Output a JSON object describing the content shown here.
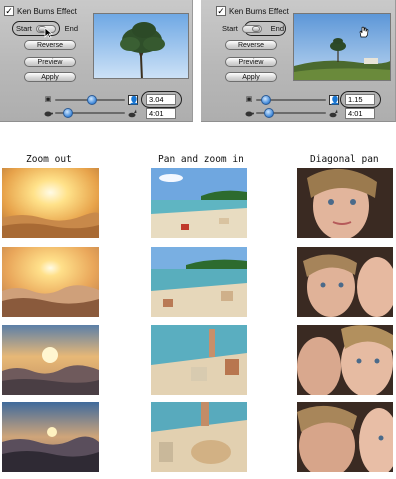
{
  "panels": [
    {
      "checkbox_label": "Ken Burns Effect",
      "checkbox_checked": true,
      "toggle_start": "Start",
      "toggle_end": "End",
      "toggle_selected": "Start",
      "buttons": [
        "Reverse",
        "Preview",
        "Apply"
      ],
      "zoom_value": "3.04",
      "duration_value": "4:01"
    },
    {
      "checkbox_label": "Ken Burns Effect",
      "checkbox_checked": true,
      "toggle_start": "Start",
      "toggle_end": "End",
      "toggle_selected": "End",
      "buttons": [
        "Reverse",
        "Preview",
        "Apply"
      ],
      "zoom_value": "1.15",
      "duration_value": "4:01"
    }
  ],
  "columns": [
    "Zoom out",
    "Pan and zoom in",
    "Diagonal pan"
  ],
  "icons": {
    "checkbox": "checkmark-icon",
    "small_photo": "small-photo-icon",
    "large_photo": "person-icon",
    "slow": "turtle-icon",
    "fast": "rabbit-icon",
    "cursor": "hand-cursor-icon",
    "pointer": "arrow-cursor-icon"
  },
  "colors": {
    "slider_knob": "#3d86d8",
    "panel_bg": "#b8b8b8"
  }
}
